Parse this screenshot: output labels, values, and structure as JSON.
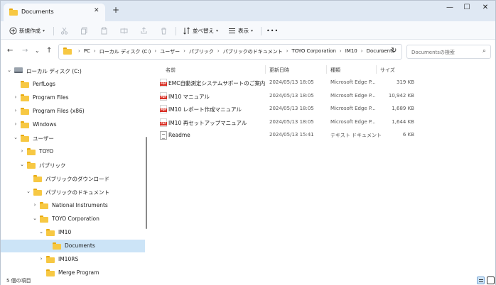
{
  "window": {
    "tab_title": "Documents",
    "tab_close": "✕",
    "tab_add": "+",
    "controls": {
      "minimize": "—",
      "maximize": "☐",
      "close": "✕"
    }
  },
  "toolbar": {
    "new": "新規作成",
    "sort": "並べ替え",
    "view": "表示",
    "more": "•••"
  },
  "address": {
    "crumbs": [
      "PC",
      "ローカル ディスク (C:)",
      "ユーザー",
      "パブリック",
      "パブリックのドキュメント",
      "TOYO Corporation",
      "IM10",
      "Documents"
    ],
    "search_placeholder": "Documentsの検索"
  },
  "tree": [
    {
      "label": "ローカル ディスク (C:)",
      "icon": "drive-icon",
      "expanded": true
    },
    {
      "label": "PerfLogs",
      "icon": "folder-icon"
    },
    {
      "label": "Program Files",
      "icon": "folder-icon",
      "expandable": true
    },
    {
      "label": "Program Files (x86)",
      "icon": "folder-icon",
      "expandable": true
    },
    {
      "label": "Windows",
      "icon": "folder-icon",
      "expandable": true
    },
    {
      "label": "ユーザー",
      "icon": "folder-icon",
      "expanded": true
    },
    {
      "label": "TOYO",
      "icon": "folder-icon",
      "expandable": true
    },
    {
      "label": "パブリック",
      "icon": "folder-icon",
      "expanded": true
    },
    {
      "label": "パブリックのダウンロード",
      "icon": "folder-icon"
    },
    {
      "label": "パブリックのドキュメント",
      "icon": "folder-icon",
      "expanded": true
    },
    {
      "label": "National Instruments",
      "icon": "folder-icon",
      "expandable": true
    },
    {
      "label": "TOYO Corporation",
      "icon": "folder-icon",
      "expanded": true
    },
    {
      "label": "IM10",
      "icon": "folder-icon",
      "expanded": true
    },
    {
      "label": "Documents",
      "icon": "folder-icon",
      "selected": true
    },
    {
      "label": "IM10RS",
      "icon": "folder-icon",
      "expandable": true
    },
    {
      "label": "Merge Program",
      "icon": "folder-icon"
    }
  ],
  "columns": {
    "name": "名前",
    "date": "更新日時",
    "type": "種類",
    "size": "サイズ"
  },
  "files": [
    {
      "name": "EMC自動測定システムサポートのご案内",
      "date": "2024/05/13 18:05",
      "type": "Microsoft Edge P...",
      "size": "319 KB",
      "icon": "pdf-icon"
    },
    {
      "name": "IM10 マニュアル",
      "date": "2024/05/13 18:05",
      "type": "Microsoft Edge P...",
      "size": "10,942 KB",
      "icon": "pdf-icon"
    },
    {
      "name": "IM10 レポート作成マニュアル",
      "date": "2024/05/13 18:05",
      "type": "Microsoft Edge P...",
      "size": "1,689 KB",
      "icon": "pdf-icon"
    },
    {
      "name": "IM10 再セットアップマニュアル",
      "date": "2024/05/13 18:05",
      "type": "Microsoft Edge P...",
      "size": "1,644 KB",
      "icon": "pdf-icon"
    },
    {
      "name": "Readme",
      "date": "2024/05/13 15:41",
      "type": "テキスト ドキュメント",
      "size": "6 KB",
      "icon": "text-file-icon"
    }
  ],
  "status": {
    "count": "5 個の項目"
  }
}
